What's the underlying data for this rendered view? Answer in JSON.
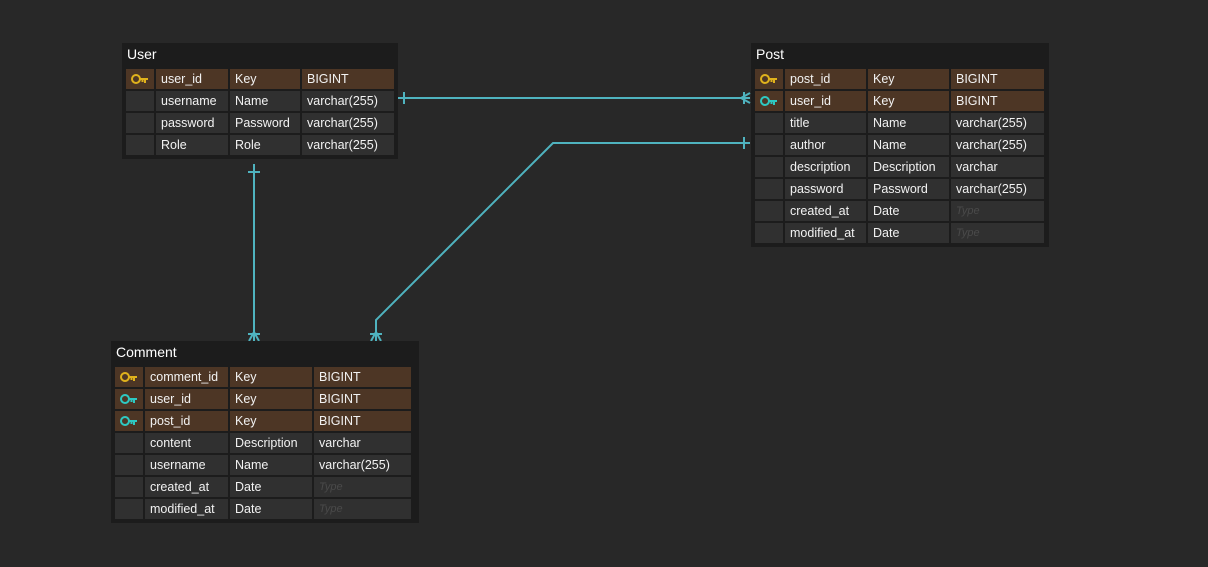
{
  "colors": {
    "background": "#282828",
    "table_background": "#1c1c1c",
    "cell_background": "#303030",
    "key_row_background": "#4d3625",
    "primary_key_icon": "#e0b21c",
    "foreign_key_icon": "#2ec9c2",
    "connector": "#4fb3bf",
    "placeholder_text": "#4a4a4a"
  },
  "tables": {
    "user": {
      "name": "User",
      "rows": [
        {
          "key": "primary-key-icon",
          "field": "user_id",
          "label": "Key",
          "type": "BIGINT"
        },
        {
          "key": "",
          "field": "username",
          "label": "Name",
          "type": "varchar(255)"
        },
        {
          "key": "",
          "field": "password",
          "label": "Password",
          "type": "varchar(255)"
        },
        {
          "key": "",
          "field": "Role",
          "label": "Role",
          "type": "varchar(255)"
        }
      ]
    },
    "post": {
      "name": "Post",
      "rows": [
        {
          "key": "primary-key-icon",
          "field": "post_id",
          "label": "Key",
          "type": "BIGINT"
        },
        {
          "key": "foreign-key-icon",
          "field": "user_id",
          "label": "Key",
          "type": "BIGINT"
        },
        {
          "key": "",
          "field": "title",
          "label": "Name",
          "type": "varchar(255)"
        },
        {
          "key": "",
          "field": "author",
          "label": "Name",
          "type": "varchar(255)"
        },
        {
          "key": "",
          "field": "description",
          "label": "Description",
          "type": "varchar"
        },
        {
          "key": "",
          "field": "password",
          "label": "Password",
          "type": "varchar(255)"
        },
        {
          "key": "",
          "field": "created_at",
          "label": "Date",
          "type": ""
        },
        {
          "key": "",
          "field": "modified_at",
          "label": "Date",
          "type": ""
        }
      ]
    },
    "comment": {
      "name": "Comment",
      "rows": [
        {
          "key": "primary-key-icon",
          "field": "comment_id",
          "label": "Key",
          "type": "BIGINT"
        },
        {
          "key": "foreign-key-icon",
          "field": "user_id",
          "label": "Key",
          "type": "BIGINT"
        },
        {
          "key": "foreign-key-icon",
          "field": "post_id",
          "label": "Key",
          "type": "BIGINT"
        },
        {
          "key": "",
          "field": "content",
          "label": "Description",
          "type": "varchar"
        },
        {
          "key": "",
          "field": "username",
          "label": "Name",
          "type": "varchar(255)"
        },
        {
          "key": "",
          "field": "created_at",
          "label": "Date",
          "type": ""
        },
        {
          "key": "",
          "field": "modified_at",
          "label": "Date",
          "type": ""
        }
      ]
    }
  },
  "type_placeholder": "Type",
  "relationships": [
    {
      "from": "User.user_id",
      "to": "Post.user_id",
      "cardinality": "one-to-many"
    },
    {
      "from": "User.user_id",
      "to": "Comment.user_id",
      "cardinality": "one-to-many"
    },
    {
      "from": "Post.post_id",
      "to": "Comment.post_id",
      "cardinality": "one-to-many"
    }
  ]
}
